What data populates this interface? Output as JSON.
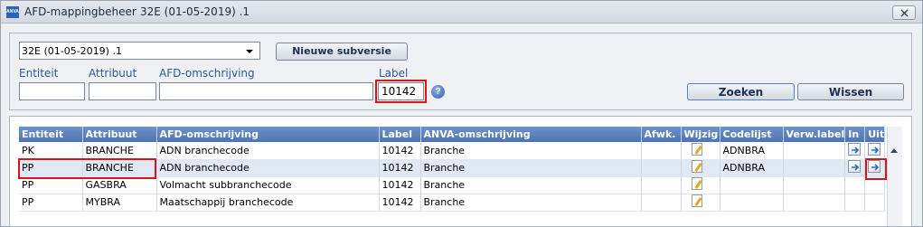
{
  "window": {
    "title": "AFD-mappingbeheer",
    "version": "32E (01-05-2019) .1",
    "app_icon_text": "ANVA"
  },
  "filter": {
    "version_select": "32E (01-05-2019) .1",
    "new_subversion_button": "Nieuwe subversie",
    "labels": {
      "entity": "Entiteit",
      "attribute": "Attribuut",
      "afd_description": "AFD-omschrijving",
      "label": "Label"
    },
    "values": {
      "entity": "",
      "attribute": "",
      "afd_description": "",
      "label": "10142"
    },
    "help_icon": "?",
    "search_button": "Zoeken",
    "clear_button": "Wissen"
  },
  "table": {
    "columns": [
      "Entiteit",
      "Attribuut",
      "AFD-omschrijving",
      "Label",
      "ANVA-omschrijving",
      "Afwk.",
      "Wijzig",
      "Codelijst",
      "Verw.label",
      "In",
      "Uit"
    ],
    "rows": [
      {
        "entity": "PK",
        "attribute": "BRANCHE",
        "afd": "ADN branchecode",
        "label": "10142",
        "anva": "Branche",
        "afwk": "",
        "codelijst": "ADNBRA",
        "verw": "",
        "has_in": true,
        "has_uit": true
      },
      {
        "entity": "PP",
        "attribute": "BRANCHE",
        "afd": "ADN branchecode",
        "label": "10142",
        "anva": "Branche",
        "afwk": "",
        "codelijst": "ADNBRA",
        "verw": "",
        "has_in": true,
        "has_uit": true
      },
      {
        "entity": "PP",
        "attribute": "GASBRA",
        "afd": "Volmacht subbranchecode",
        "label": "10142",
        "anva": "Branche",
        "afwk": "",
        "codelijst": "",
        "verw": "",
        "has_in": false,
        "has_uit": false
      },
      {
        "entity": "PP",
        "attribute": "MYBRA",
        "afd": "Maatschappij branchecode",
        "label": "10142",
        "anva": "Branche",
        "afwk": "",
        "codelijst": "",
        "verw": "",
        "has_in": false,
        "has_uit": false
      }
    ],
    "selected_row": 1
  },
  "colors": {
    "header_blue": "#5a7fbc",
    "highlight_red": "#d6161c",
    "selected_row": "#dfe8f4"
  }
}
